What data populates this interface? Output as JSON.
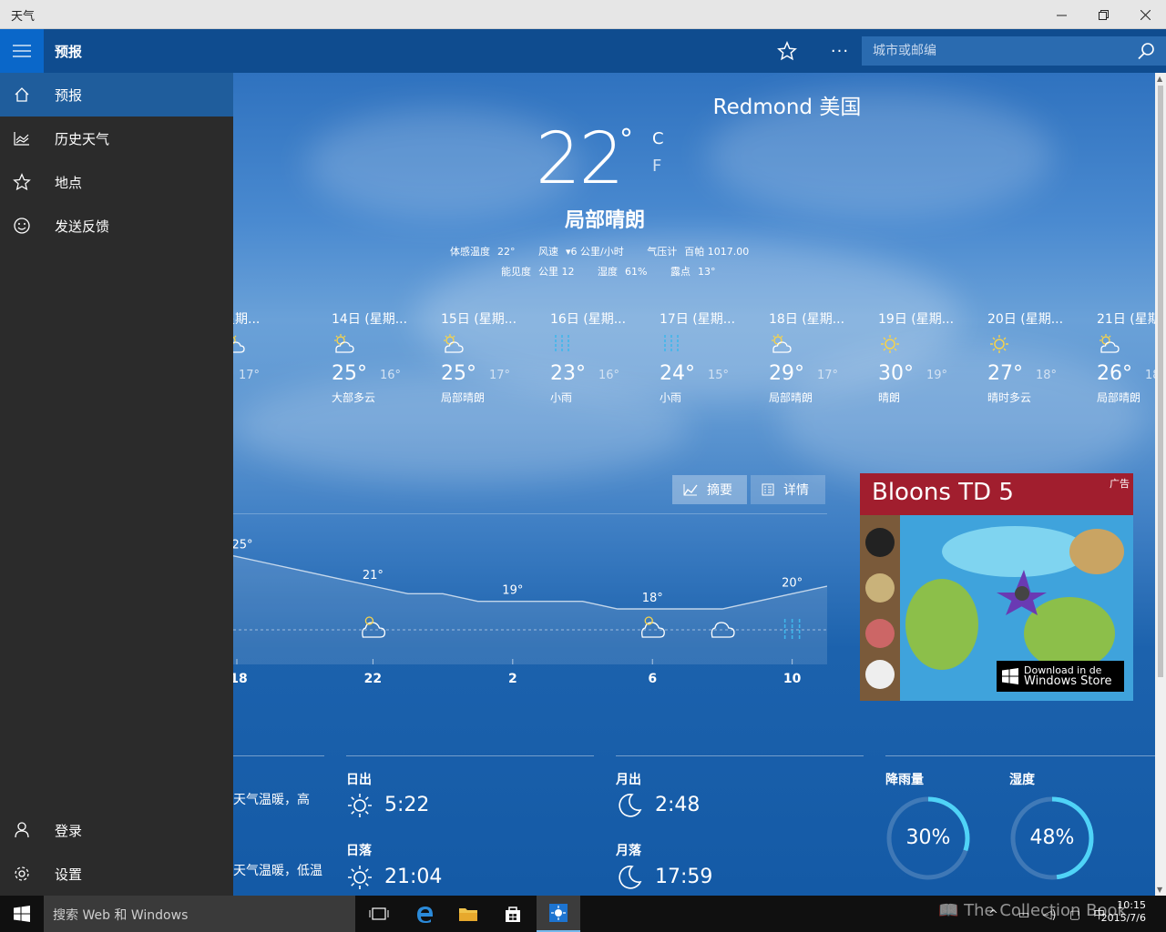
{
  "window": {
    "title": "天气"
  },
  "appbar": {
    "title": "预报",
    "search_placeholder": "城市或邮编"
  },
  "sidebar": {
    "items": [
      {
        "label": "预报",
        "icon": "home-icon"
      },
      {
        "label": "历史天气",
        "icon": "chart-icon"
      },
      {
        "label": "地点",
        "icon": "star-icon"
      },
      {
        "label": "发送反馈",
        "icon": "smiley-icon"
      }
    ],
    "bottom": [
      {
        "label": "登录",
        "icon": "person-icon"
      },
      {
        "label": "设置",
        "icon": "gear-icon"
      }
    ]
  },
  "current": {
    "city": "Redmond 美国",
    "temp": "22",
    "deg": "°",
    "unit_c": "C",
    "unit_f": "F",
    "condition": "局部晴朗",
    "feels_label": "体感温度",
    "feels": "22°",
    "wind_label": "风速",
    "wind": "6 公里/小时",
    "pressure_label": "气压计",
    "pressure": "百帕 1017.00",
    "visibility_label": "能见度",
    "visibility": "公里 12",
    "humidity_label": "湿度",
    "humidity": "61%",
    "dew_label": "露点",
    "dew": "13°"
  },
  "forecast": [
    {
      "day": "星期...",
      "hi": "",
      "lo": "17°",
      "cond": "朗",
      "icon": "partly-sunny-icon"
    },
    {
      "day": "14日 (星期...",
      "hi": "25°",
      "lo": "16°",
      "cond": "大部多云",
      "icon": "partly-sunny-icon"
    },
    {
      "day": "15日 (星期...",
      "hi": "25°",
      "lo": "17°",
      "cond": "局部晴朗",
      "icon": "partly-sunny-icon"
    },
    {
      "day": "16日 (星期...",
      "hi": "23°",
      "lo": "16°",
      "cond": "小雨",
      "icon": "rain-icon"
    },
    {
      "day": "17日 (星期...",
      "hi": "24°",
      "lo": "15°",
      "cond": "小雨",
      "icon": "rain-icon"
    },
    {
      "day": "18日 (星期...",
      "hi": "29°",
      "lo": "17°",
      "cond": "局部晴朗",
      "icon": "partly-sunny-icon"
    },
    {
      "day": "19日 (星期...",
      "hi": "30°",
      "lo": "19°",
      "cond": "晴朗",
      "icon": "sun-icon"
    },
    {
      "day": "20日 (星期...",
      "hi": "27°",
      "lo": "18°",
      "cond": "晴时多云",
      "icon": "sun-icon"
    },
    {
      "day": "21日 (星期",
      "hi": "26°",
      "lo": "18°",
      "cond": "局部晴朗",
      "icon": "partly-sunny-icon"
    }
  ],
  "chart_tabs": {
    "summary": "摘要",
    "details": "详情"
  },
  "chart_data": {
    "type": "line",
    "x": [
      18,
      19,
      20,
      21,
      22,
      23,
      0,
      1,
      2,
      3,
      4,
      5,
      6,
      7,
      8,
      9,
      10,
      11
    ],
    "values": [
      25,
      24,
      23,
      22,
      21,
      20,
      20,
      19,
      19,
      19,
      19,
      18,
      18,
      18,
      18,
      19,
      20,
      21
    ],
    "xticks": [
      "18",
      "22",
      "2",
      "6",
      "10"
    ],
    "value_labels": [
      "25°",
      "21°",
      "19°",
      "18°",
      "20°"
    ],
    "ylim": [
      15,
      27
    ]
  },
  "ad": {
    "title": "Bloons TD 5",
    "badge": "广告",
    "store_line1": "Download in de",
    "store_line2": "Windows Store"
  },
  "bottom": {
    "left_text1": "天气温暖，高",
    "left_text2": "天气温暖，低温",
    "sunrise_label": "日出",
    "sunrise": "5:22",
    "sunset_label": "日落",
    "sunset": "21:04",
    "moonrise_label": "月出",
    "moonrise": "2:48",
    "moonset_label": "月落",
    "moonset": "17:59",
    "precip_label": "降雨量",
    "precip": "30%",
    "precip_value": 30,
    "humid_label": "湿度",
    "humid": "48%",
    "humid_value": 48
  },
  "taskbar": {
    "search": "搜索 Web 和 Windows",
    "time": "10:15",
    "date": "2015/7/6",
    "ime": "中"
  },
  "watermark": "The Collection Book",
  "colors": {
    "accent": "#0f4c8f",
    "sidebar": "#2b2b2b",
    "ring": "#4fd3f7"
  }
}
